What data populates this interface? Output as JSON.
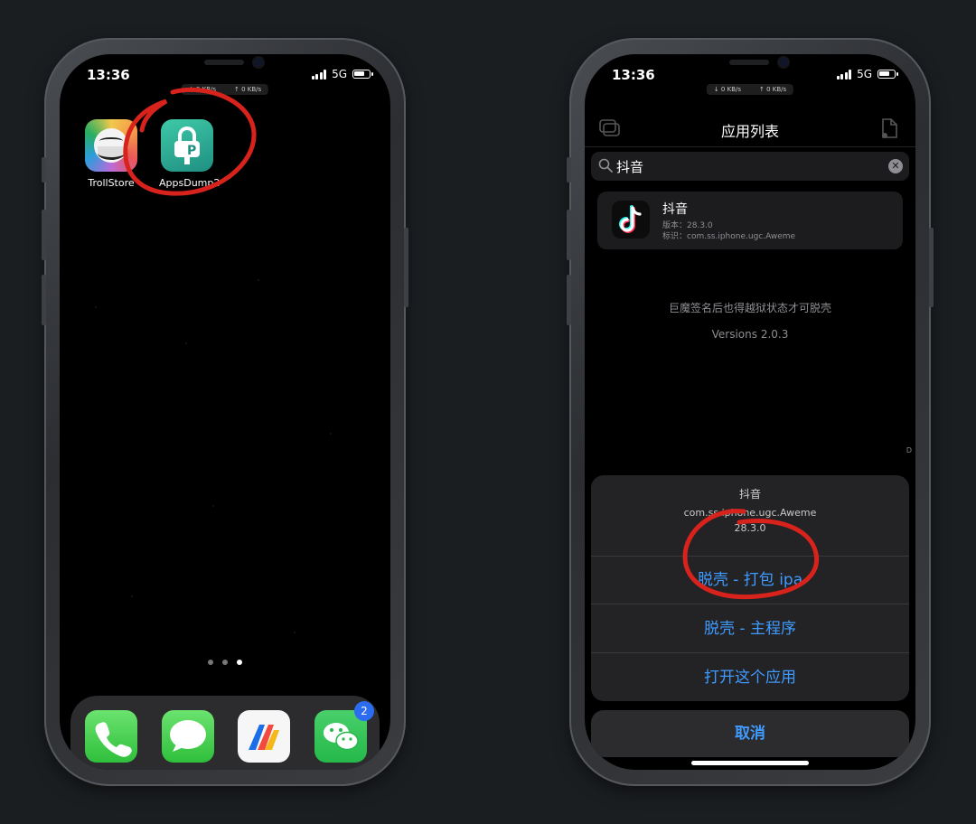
{
  "left_phone": {
    "status": {
      "time": "13:36",
      "network": "5G",
      "down_speed": "↓ 0 KB/s",
      "up_speed": "↑ 0 KB/s"
    },
    "apps": [
      {
        "label": "TrollStore",
        "icon": "trollstore-icon"
      },
      {
        "label": "AppsDump2",
        "icon": "appsdump2-icon"
      }
    ],
    "page_dots": {
      "count": 3,
      "active_index": 2
    },
    "dock": [
      {
        "icon": "phone-icon"
      },
      {
        "icon": "messages-icon"
      },
      {
        "icon": "vpn-app-icon"
      },
      {
        "icon": "wechat-icon",
        "badge": "2"
      }
    ],
    "annotation_color": "#d8231d"
  },
  "right_phone": {
    "status": {
      "time": "13:36",
      "network": "5G",
      "down_speed": "↓ 0 KB/s",
      "up_speed": "↑ 0 KB/s"
    },
    "nav": {
      "title": "应用列表"
    },
    "search": {
      "value": "抖音"
    },
    "app_card": {
      "name": "抖音",
      "version_label": "版本：",
      "version": "28.3.0",
      "bundle_label": "标识：",
      "bundle_id": "com.ss.iphone.ugc.Aweme"
    },
    "notes": {
      "hint": "巨魔签名后也得越狱状态才可脱壳",
      "version_text": "Versions 2.0.3",
      "side_mark": "D"
    },
    "action_sheet": {
      "title": "抖音",
      "bundle_id": "com.ss.iphone.ugc.Aweme",
      "version": "28.3.0",
      "actions": [
        "脱壳 - 打包 ipa",
        "脱壳 - 主程序",
        "打开这个应用"
      ],
      "cancel": "取消"
    },
    "accent_color": "#3f9bff"
  }
}
